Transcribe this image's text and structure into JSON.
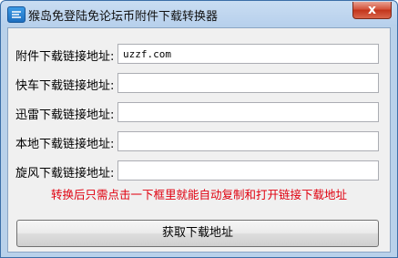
{
  "window": {
    "title": "猴岛免登陆免论坛币附件下载转换器",
    "close_glyph": "x"
  },
  "form": {
    "rows": [
      {
        "label": "附件下载链接地址:",
        "value": "uzzf.com"
      },
      {
        "label": "快车下载链接地址:",
        "value": ""
      },
      {
        "label": "迅雷下载链接地址:",
        "value": ""
      },
      {
        "label": "本地下载链接地址:",
        "value": ""
      },
      {
        "label": "旋风下载链接地址:",
        "value": ""
      }
    ],
    "notice": "转换后只需点击一下框里就能自动复制和打开链接下载地址",
    "notice_color": "#e0000f",
    "submit_label": "获取下载地址"
  }
}
